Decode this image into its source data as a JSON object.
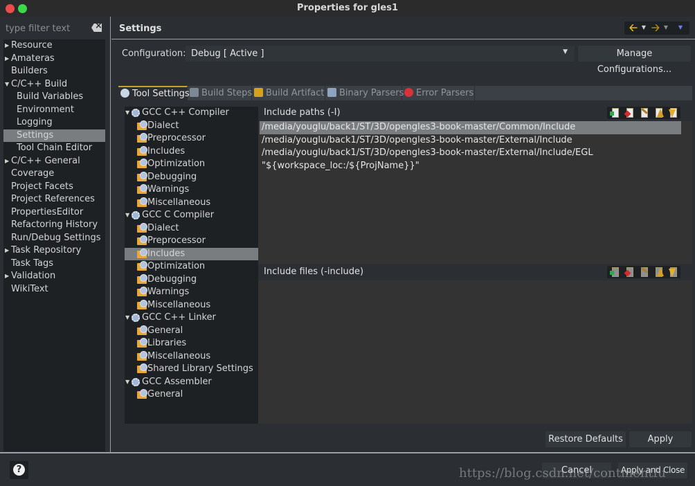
{
  "window": {
    "title": "Properties for gles1"
  },
  "filter": {
    "placeholder": "type filter text",
    "value": ""
  },
  "sidebar": {
    "items": [
      {
        "label": "Resource",
        "expander": "collapsed",
        "level": 0
      },
      {
        "label": "Amateras",
        "expander": "collapsed",
        "level": 0
      },
      {
        "label": "Builders",
        "expander": "none",
        "level": 0
      },
      {
        "label": "C/C++ Build",
        "expander": "expanded",
        "level": 0
      },
      {
        "label": "Build Variables",
        "expander": "none",
        "level": 1
      },
      {
        "label": "Environment",
        "expander": "none",
        "level": 1
      },
      {
        "label": "Logging",
        "expander": "none",
        "level": 1
      },
      {
        "label": "Settings",
        "expander": "none",
        "level": 1,
        "selected": true
      },
      {
        "label": "Tool Chain Editor",
        "expander": "none",
        "level": 1
      },
      {
        "label": "C/C++ General",
        "expander": "collapsed",
        "level": 0
      },
      {
        "label": "Coverage",
        "expander": "none",
        "level": 0
      },
      {
        "label": "Project Facets",
        "expander": "none",
        "level": 0
      },
      {
        "label": "Project References",
        "expander": "none",
        "level": 0
      },
      {
        "label": "PropertiesEditor",
        "expander": "none",
        "level": 0
      },
      {
        "label": "Refactoring History",
        "expander": "none",
        "level": 0
      },
      {
        "label": "Run/Debug Settings",
        "expander": "none",
        "level": 0
      },
      {
        "label": "Task Repository",
        "expander": "collapsed",
        "level": 0
      },
      {
        "label": "Task Tags",
        "expander": "none",
        "level": 0
      },
      {
        "label": "Validation",
        "expander": "collapsed",
        "level": 0
      },
      {
        "label": "WikiText",
        "expander": "none",
        "level": 0
      }
    ]
  },
  "header": {
    "title": "Settings",
    "nav": {
      "back_icon": "arrow-left-icon",
      "forward_icon": "arrow-right-icon",
      "menu_icon": "view-menu-icon"
    }
  },
  "configuration": {
    "label": "Configuration:",
    "value": "Debug  [ Active ]",
    "manage_label": "Manage Configurations..."
  },
  "tabs": [
    {
      "label": "Tool Settings",
      "icon": "tool-settings-icon",
      "active": true
    },
    {
      "label": "Build Steps",
      "icon": "build-steps-icon",
      "active": false
    },
    {
      "label": "Build Artifact",
      "icon": "trophy-icon",
      "active": false
    },
    {
      "label": "Binary Parsers",
      "icon": "binary-icon",
      "active": false
    },
    {
      "label": "Error Parsers",
      "icon": "error-icon",
      "active": false
    }
  ],
  "tool_tree": {
    "tools": [
      {
        "label": "GCC C++ Compiler",
        "options": [
          "Dialect",
          "Preprocessor",
          "Includes",
          "Optimization",
          "Debugging",
          "Warnings",
          "Miscellaneous"
        ]
      },
      {
        "label": "GCC C Compiler",
        "options": [
          "Dialect",
          "Preprocessor",
          "Includes",
          "Optimization",
          "Debugging",
          "Warnings",
          "Miscellaneous"
        ],
        "selected_option": "Includes"
      },
      {
        "label": "GCC C++ Linker",
        "options": [
          "General",
          "Libraries",
          "Miscellaneous",
          "Shared Library Settings"
        ]
      },
      {
        "label": "GCC Assembler",
        "options": [
          "General"
        ]
      }
    ]
  },
  "include_paths": {
    "title": "Include paths (-I)",
    "items": [
      "/media/youglu/back1/ST/3D/opengles3-book-master/Common/Include",
      "/media/youglu/back1/ST/3D/opengles3-book-master/External/Include",
      "/media/youglu/back1/ST/3D/opengles3-book-master/External/Include/EGL",
      "\"${workspace_loc:/${ProjName}}\""
    ],
    "selected_index": 0,
    "actions": [
      "add-icon",
      "delete-icon",
      "edit-icon",
      "move-up-icon",
      "move-down-icon"
    ]
  },
  "include_files": {
    "title": "Include files (-include)",
    "items": [],
    "actions": [
      "add-icon",
      "delete-icon",
      "edit-icon",
      "move-up-icon",
      "move-down-icon"
    ]
  },
  "buttons": {
    "restore_defaults": "Restore Defaults",
    "apply": "Apply",
    "cancel": "Cancel",
    "apply_and_close": "Apply and Close",
    "help": "?"
  },
  "watermark": "https://blog.csdn.net/continentfu",
  "colors": {
    "selection": "#7a7d80",
    "active_tab_accent": "#c8a12c",
    "back_arrow": "#f2c21b",
    "close_dot": "#ee4b4b",
    "max_dot": "#3ad94a"
  }
}
